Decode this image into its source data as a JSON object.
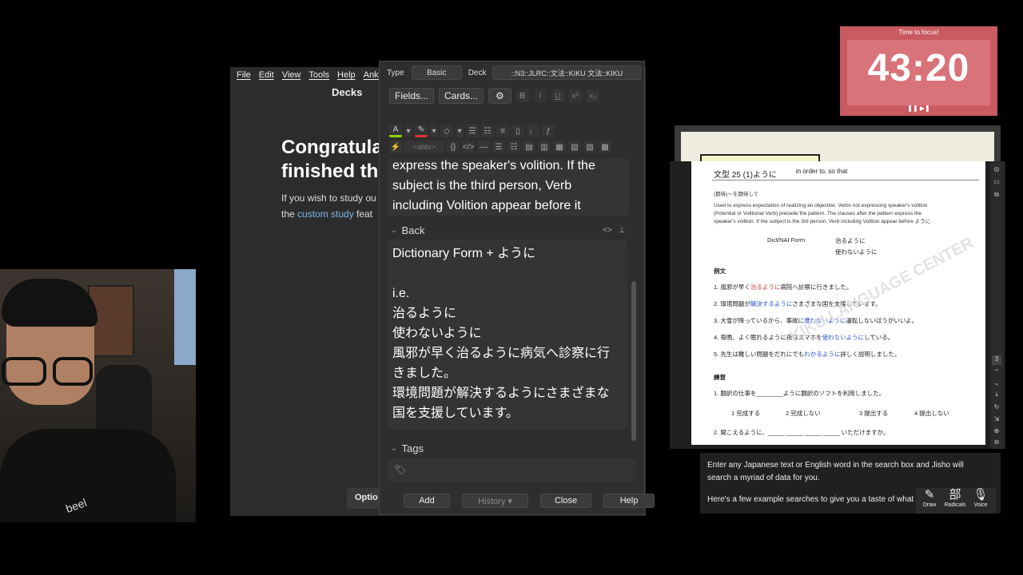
{
  "anki_main": {
    "menu": [
      "File",
      "Edit",
      "View",
      "Tools",
      "Help",
      "Anki"
    ],
    "title": "Decks",
    "congrats_line1": "Congratula",
    "congrats_line2": "finished th",
    "desc_line1": "If you wish to study ou",
    "desc_pre": "the ",
    "desc_link": "custom study",
    "desc_post": " feat",
    "options_label": "Optio"
  },
  "add_dialog": {
    "type_label": "Type",
    "type_value": "Basic",
    "deck_label": "Deck",
    "deck_value": "::N3::JLRC::文法::KIKU 文法::KIKU",
    "fields_button": "Fields...",
    "cards_button": "Cards...",
    "front_text": [
      "express the speaker's volition. If the",
      "subject is the third person, Verb",
      "including Volition appear before it"
    ],
    "back_label": "Back",
    "back_lines": [
      "Dictionary Form + ように",
      "",
      "i.e.",
      "治るように",
      "使わないように",
      "風邪が早く治るように病気へ診察に行",
      "きました。",
      "環境問題が解決するようにさまざまな",
      "国を支援しています。"
    ],
    "tags_label": "Tags",
    "buttons": {
      "add": "Add",
      "history": "History ▾",
      "close": "Close",
      "help": "Help"
    }
  },
  "webcam": {
    "shirt_text": "beel"
  },
  "timer": {
    "label": "Time to focus!",
    "time": "43:20",
    "controls": "❚❚ ▶❚"
  },
  "pdf": {
    "title": "文型 25 (1)ように",
    "title_en": "in order to, so that",
    "meaning": "(期待)～を期待して",
    "explain_1": "Used to express expectation of realizing an objective. Verbs not expressing speaker's volition",
    "explain_2": "(Potential or Volitional Verb) precede the pattern. The clauses after the pattern express the",
    "explain_3": "speaker's volition. If the subject is the 3rd person, Verb including Volition appear before ように.",
    "form_label": "Dict/NAI Form",
    "form_1": "治るように",
    "form_2": "使わないように",
    "examples_heading": "例文",
    "examples": [
      {
        "pre": "1. 風邪が早く",
        "hl": "治るように",
        "post": "病院へ診察に行きました。",
        "color": "red"
      },
      {
        "pre": "2. 環境問題が",
        "hl": "解決するように",
        "post": "さまざまな国を支援しています。",
        "color": "blue"
      },
      {
        "pre": "3. 大雪が降っているから、事故に",
        "hl": "遭わないように",
        "post": "運転しないほうがいいよ。",
        "color": "blue"
      },
      {
        "pre": "4. 毎晩、よく眠れるように夜はスマホを",
        "hl": "使わないように",
        "post": "している。",
        "color": "blue"
      },
      {
        "pre": "5. 先生は難しい問題をだれにでも",
        "hl": "わかるように",
        "post": "詳しく説明しました。",
        "color": "blue"
      }
    ],
    "practice_heading": "練習",
    "practice_1": "1. 翻訳の仕事を________ように翻訳のソフトを利用しました。",
    "choices": [
      "1 完成する",
      "2 完成しない",
      "3 提出する",
      "4 提出しない"
    ],
    "practice_2": "2. 聞こえるように、_____ _____ _____ _____ いただけますか。",
    "watermark": "KIKU LANGUAGE CENTER",
    "page_num": "3"
  },
  "jisho": {
    "line1": "Enter any Japanese text or English word in the search box and Jisho will search a myriad of data for you.",
    "line2": "Here's a few example searches to give you a taste of what Jisho",
    "tools": [
      {
        "glyph": "✎",
        "label": "Draw"
      },
      {
        "glyph": "部",
        "label": "Radicals"
      },
      {
        "glyph": "🎙",
        "label": "Voice"
      }
    ]
  },
  "colors": {
    "timer_bg": "#c95a61",
    "link": "#7fb6ee",
    "dialog_bg": "#2e2e2e"
  }
}
